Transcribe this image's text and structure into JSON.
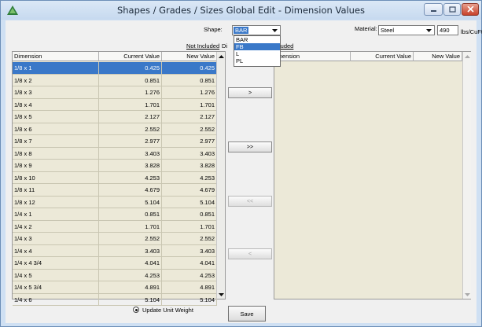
{
  "window": {
    "title": "Shapes / Grades / Sizes Global Edit - Dimension Values"
  },
  "shape": {
    "label": "Shape:",
    "value": "BAR",
    "options": [
      "BAR",
      "FB",
      "L",
      "PL"
    ],
    "highlighted": "FB"
  },
  "material": {
    "label": "Material:",
    "value": "Steel",
    "density": "490",
    "unit": "lbs/CuFt"
  },
  "not_included": {
    "label": "Not Included",
    "columns": [
      "Dimension",
      "Current Value",
      "New Value"
    ],
    "rows": [
      [
        "1/8 x 1",
        "0.425",
        "0.425"
      ],
      [
        "1/8 x 2",
        "0.851",
        "0.851"
      ],
      [
        "1/8 x 3",
        "1.276",
        "1.276"
      ],
      [
        "1/8 x 4",
        "1.701",
        "1.701"
      ],
      [
        "1/8 x 5",
        "2.127",
        "2.127"
      ],
      [
        "1/8 x 6",
        "2.552",
        "2.552"
      ],
      [
        "1/8 x 7",
        "2.977",
        "2.977"
      ],
      [
        "1/8 x 8",
        "3.403",
        "3.403"
      ],
      [
        "1/8 x 9",
        "3.828",
        "3.828"
      ],
      [
        "1/8 x 10",
        "4.253",
        "4.253"
      ],
      [
        "1/8 x 11",
        "4.679",
        "4.679"
      ],
      [
        "1/8 x 12",
        "5.104",
        "5.104"
      ],
      [
        "1/4 x 1",
        "0.851",
        "0.851"
      ],
      [
        "1/4 x 2",
        "1.701",
        "1.701"
      ],
      [
        "1/4 x 3",
        "2.552",
        "2.552"
      ],
      [
        "1/4 x 4",
        "3.403",
        "3.403"
      ],
      [
        "1/4 x 4 3/4",
        "4.041",
        "4.041"
      ],
      [
        "1/4 x 5",
        "4.253",
        "4.253"
      ],
      [
        "1/4 x 5 3/4",
        "4.891",
        "4.891"
      ],
      [
        "1/4 x 6",
        "5.104",
        "5.104"
      ]
    ],
    "selected_index": 0
  },
  "included": {
    "label_prefix": "Di",
    "label_suffix": "luded",
    "columns": [
      "imension",
      "Current Value",
      "New Value"
    ],
    "rows": []
  },
  "buttons": {
    "move_one_right": ">",
    "move_all_right": ">>",
    "move_all_left": "<<",
    "move_one_left": "<",
    "save": "Save"
  },
  "update_unit_weight": {
    "label": "Update Unit Weight",
    "selected": true
  },
  "colors": {
    "selection": "#3a78c8",
    "window_frame": "#cfe0f3",
    "grid_bg": "#ece9d8"
  }
}
